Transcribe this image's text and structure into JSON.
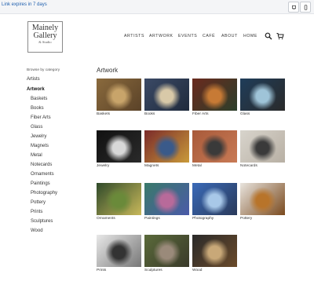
{
  "topbar": {
    "expires_text": "Link expires in 7 days"
  },
  "logo": {
    "line1": "Mainely",
    "line2": "Gallery",
    "line3": "& Studio"
  },
  "nav": [
    "ARTISTS",
    "ARTWORK",
    "EVENTS",
    "CAFÉ",
    "ABOUT",
    "HOME"
  ],
  "sidebar": {
    "browse_label": "Browse by category",
    "artists_label": "Artists",
    "artwork_label": "Artwork",
    "categories": [
      "Baskets",
      "Books",
      "Fiber Arts",
      "Glass",
      "Jewelry",
      "Magnets",
      "Metal",
      "Notecards",
      "Ornaments",
      "Paintings",
      "Photography",
      "Pottery",
      "Prints",
      "Sculptures",
      "Wood"
    ]
  },
  "main": {
    "title": "Artwork",
    "tiles": [
      {
        "label": "Baskets",
        "colors": [
          "#8a6a3d",
          "#c8a46a",
          "#5a4228"
        ]
      },
      {
        "label": "Books",
        "colors": [
          "#3b4a66",
          "#d8c9a8",
          "#1f2a3c"
        ]
      },
      {
        "label": "Fiber Arts",
        "colors": [
          "#6a2a1e",
          "#c77a35",
          "#2c3f2a"
        ]
      },
      {
        "label": "Glass",
        "colors": [
          "#1f3d5a",
          "#9fc4d8",
          "#2a2a2a"
        ]
      },
      {
        "label": "Jewelry",
        "colors": [
          "#111111",
          "#d8d8d8",
          "#2a2a2a"
        ]
      },
      {
        "label": "Magnets",
        "colors": [
          "#7a2a2a",
          "#3a5a8a",
          "#c99a3a"
        ]
      },
      {
        "label": "Metal",
        "colors": [
          "#a85a3a",
          "#3a3a3a",
          "#c87a55"
        ]
      },
      {
        "label": "Notecards",
        "colors": [
          "#d8d4cc",
          "#3a3a3a",
          "#b8b0a4"
        ]
      },
      {
        "label": "Ornaments",
        "colors": [
          "#2f4a2a",
          "#6a8a3a",
          "#c8b85a"
        ]
      },
      {
        "label": "Paintings",
        "colors": [
          "#3a7a6a",
          "#b86a9a",
          "#4a5aa8"
        ]
      },
      {
        "label": "Photography",
        "colors": [
          "#3a6ab8",
          "#a8c8e8",
          "#2a3a5a"
        ]
      },
      {
        "label": "Pottery",
        "colors": [
          "#e8e4de",
          "#b8742a",
          "#7a4a1e"
        ]
      },
      {
        "label": "Prints",
        "colors": [
          "#e8e8e8",
          "#333333",
          "#777777"
        ]
      },
      {
        "label": "Sculptures",
        "colors": [
          "#5a6a3a",
          "#9a8a7a",
          "#3a3a2a"
        ]
      },
      {
        "label": "Wood",
        "colors": [
          "#2a2a2a",
          "#c8a878",
          "#6a4a2a"
        ]
      }
    ]
  }
}
